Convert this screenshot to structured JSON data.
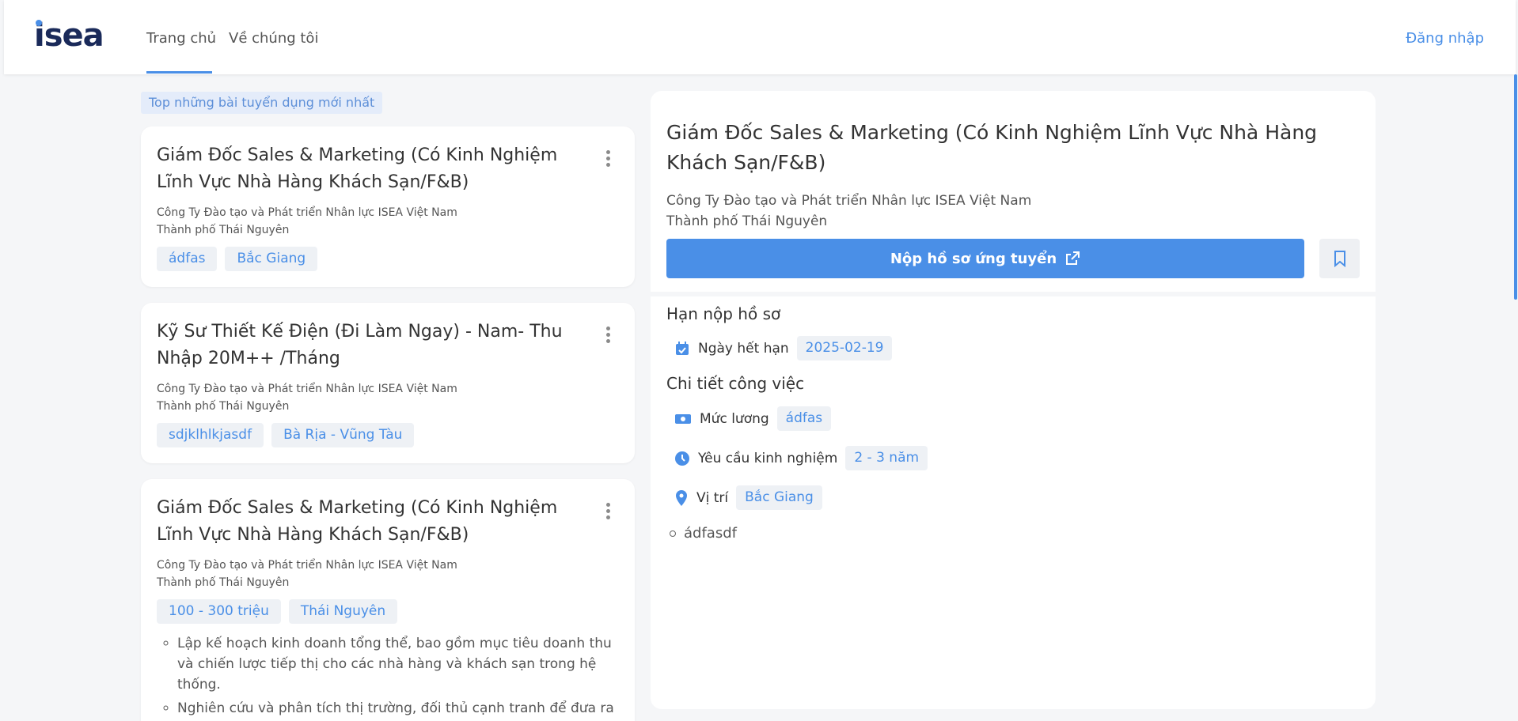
{
  "header": {
    "nav": [
      "Trang chủ",
      "Về chúng tôi"
    ],
    "login": "Đăng nhập",
    "logo_text": "isea"
  },
  "section_label": "Top những bài tuyển dụng mới nhất",
  "cards": [
    {
      "title": "Giám Đốc Sales & Marketing (Có Kinh Nghiệm Lĩnh Vực Nhà Hàng Khách Sạn/F&B)",
      "company": "Công Ty Đào tạo và Phát triển Nhân lực ISEA Việt Nam",
      "city": "Thành phố Thái Nguyên",
      "tags": [
        "ádfas",
        "Bắc Giang"
      ]
    },
    {
      "title": "Kỹ Sư Thiết Kế Điện (Đi Làm Ngay) - Nam- Thu Nhập 20M++ /Tháng",
      "company": "Công Ty Đào tạo và Phát triển Nhân lực ISEA Việt Nam",
      "city": "Thành phố Thái Nguyên",
      "tags": [
        "sdjklhlkjasdf",
        "Bà Rịa - Vũng Tàu"
      ]
    },
    {
      "title": "Giám Đốc Sales & Marketing (Có Kinh Nghiệm Lĩnh Vực Nhà Hàng Khách Sạn/F&B)",
      "company": "Công Ty Đào tạo và Phát triển Nhân lực ISEA Việt Nam",
      "city": "Thành phố Thái Nguyên",
      "tags": [
        "100 - 300 triệu",
        "Thái Nguyên"
      ],
      "bullets": [
        "Lập kế hoạch kinh doanh tổng thể, bao gồm mục tiêu doanh thu và chiến lược tiếp thị cho các nhà hàng và khách sạn trong hệ thống.",
        "Nghiên cứu và phân tích thị trường, đối thủ cạnh tranh để đưa ra các chiến lược phù hợp."
      ]
    }
  ],
  "detail": {
    "title": "Giám Đốc Sales & Marketing (Có Kinh Nghiệm Lĩnh Vực Nhà Hàng Khách Sạn/F&B)",
    "company": "Công Ty Đào tạo và Phát triển Nhân lực ISEA Việt Nam",
    "city": "Thành phố Thái Nguyên",
    "apply_label": "Nộp hồ sơ ứng tuyển",
    "deadline_heading": "Hạn nộp hồ sơ",
    "deadline_label": "Ngày hết hạn",
    "deadline_value": "2025-02-19",
    "job_heading": "Chi tiết công việc",
    "salary_label": "Mức lương",
    "salary_value": "ádfas",
    "experience_label": "Yêu cầu kinh nghiệm",
    "experience_value": "2 - 3 năm",
    "location_label": "Vị trí",
    "location_value": "Bắc Giang",
    "bullet": "ádfasdf"
  },
  "colors": {
    "accent": "#4a8fe7",
    "background": "#f5f6f8",
    "tag_bg": "#eef1f5"
  }
}
